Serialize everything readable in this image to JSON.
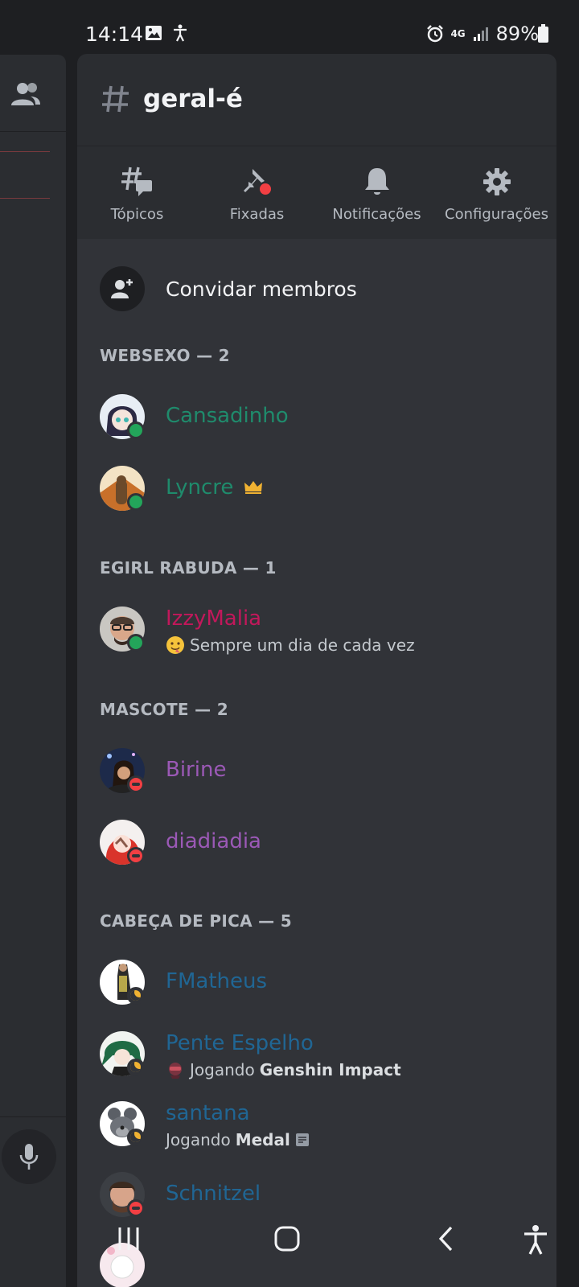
{
  "status_bar": {
    "time": "14:14",
    "network": "4G",
    "battery": "89%"
  },
  "channel": {
    "name": "geral-é"
  },
  "actions": [
    {
      "label": "Tópicos",
      "icon": "threads-icon"
    },
    {
      "label": "Fixadas",
      "icon": "pin-icon"
    },
    {
      "label": "Notificações",
      "icon": "bell-icon"
    },
    {
      "label": "Configurações",
      "icon": "gear-icon"
    }
  ],
  "invite": {
    "label": "Convidar membros"
  },
  "groups": [
    {
      "title": "WEBSEXO — 2"
    },
    {
      "title": "EGIRL RABUDA — 1"
    },
    {
      "title": "MASCOTE — 2"
    },
    {
      "title": "CABEÇA DE PICA — 5"
    }
  ],
  "members": [
    {
      "name": "Cansadinho",
      "color": "#1f8b6c",
      "presence": "online"
    },
    {
      "name": "Lyncre",
      "color": "#1f8b6c",
      "presence": "online",
      "owner": true
    },
    {
      "name": "IzzyMalia",
      "color": "#c2185b",
      "presence": "online",
      "status_text": "Sempre um dia de cada vez"
    },
    {
      "name": "Birine",
      "color": "#9b59b6",
      "presence": "dnd"
    },
    {
      "name": "diadiadia",
      "color": "#9b59b6",
      "presence": "dnd"
    },
    {
      "name": "FMatheus",
      "color": "#206694",
      "presence": "idle"
    },
    {
      "name": "Pente Espelho",
      "color": "#206694",
      "presence": "idle",
      "activity_prefix": "Jogando",
      "activity_name": "Genshin Impact"
    },
    {
      "name": "santana",
      "color": "#206694",
      "presence": "idle",
      "activity_prefix": "Jogando",
      "activity_name": "Medal"
    },
    {
      "name": "Schnitzel",
      "color": "#206694",
      "presence": "dnd"
    }
  ]
}
